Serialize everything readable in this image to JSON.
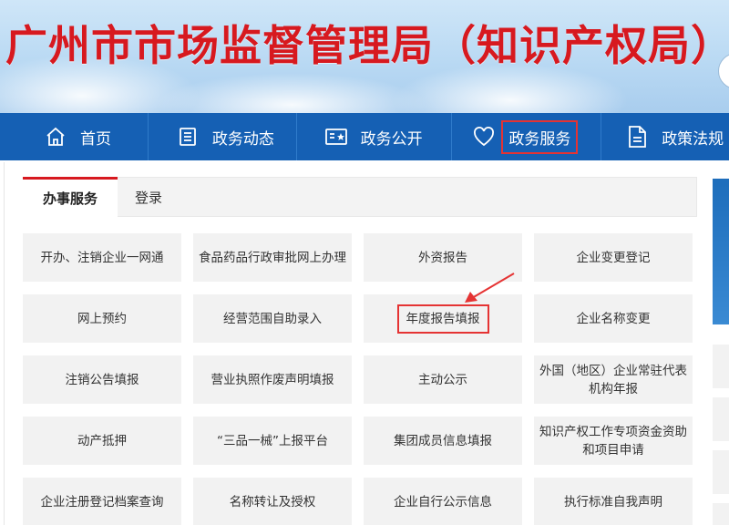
{
  "header": {
    "title": "广州市市场监督管理局（知识产权局）"
  },
  "nav": {
    "items": [
      {
        "label": "首页",
        "icon": "home-icon"
      },
      {
        "label": "政务动态",
        "icon": "document-list-icon"
      },
      {
        "label": "政务公开",
        "icon": "bulletin-star-icon"
      },
      {
        "label": "政务服务",
        "icon": "heart-icon"
      },
      {
        "label": "政策法规",
        "icon": "file-icon"
      }
    ]
  },
  "tabs": {
    "active": "办事服务",
    "login": "登录"
  },
  "services": [
    "开办、注销企业一网通",
    "食品药品行政审批网上办理",
    "外资报告",
    "企业变更登记",
    "网上预约",
    "经营范围自助录入",
    "年度报告填报",
    "企业名称变更",
    "注销公告填报",
    "营业执照作废声明填报",
    "主动公示",
    "外国（地区）企业常驻代表机构年报",
    "动产抵押",
    "“三品一械”上报平台",
    "集团成员信息填报",
    "知识产权工作专项资金资助和项目申请",
    "企业注册登记档案查询",
    "名称转让及授权",
    "企业自行公示信息",
    "执行标准自我声明"
  ],
  "colors": {
    "title_red": "#d7191f",
    "nav_blue": "#1560b4",
    "highlight_red": "#e53333",
    "cell_bg": "#f2f2f2"
  }
}
